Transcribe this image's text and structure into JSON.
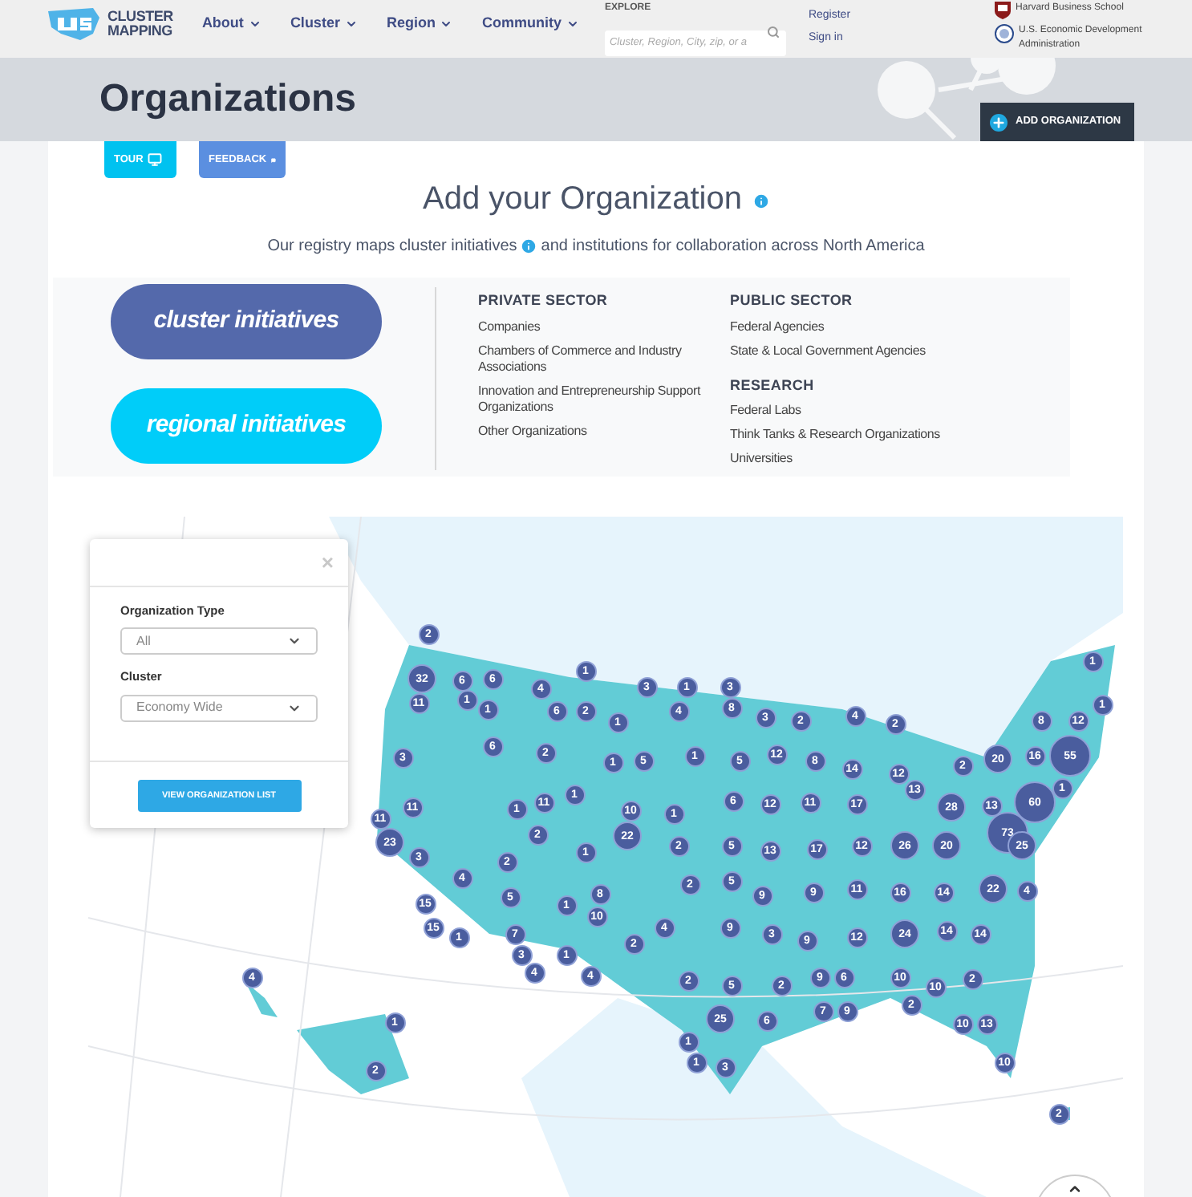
{
  "header": {
    "logo_lines": [
      "CLUSTER",
      "MAPPING"
    ],
    "nav": [
      "About",
      "Cluster",
      "Region",
      "Community"
    ],
    "explore": {
      "label": "EXPLORE",
      "placeholder": "Cluster, Region, City, zip, or a"
    },
    "account_links": [
      "Register",
      "Sign in"
    ],
    "partners": [
      {
        "name": "Harvard Business School",
        "kind": "shield"
      },
      {
        "name": "U.S. Economic Development Administration",
        "kind": "seal"
      }
    ]
  },
  "banner": {
    "title": "Organizations",
    "add_button": "ADD ORGANIZATION"
  },
  "tabs": [
    {
      "label": "TOUR",
      "kind": "tour"
    },
    {
      "label": "FEEDBACK",
      "kind": "feedback"
    }
  ],
  "intro": {
    "heading": "Add your Organization",
    "subtitle_before": "Our registry maps cluster initiatives",
    "subtitle_after": "and institutions for collaboration across North America"
  },
  "initiatives": [
    {
      "label": "cluster initiatives",
      "color": "#5469ab"
    },
    {
      "label": "regional initiatives",
      "color": "#00cdf9"
    }
  ],
  "sectors": [
    {
      "groups": [
        {
          "title": "PRIVATE SECTOR",
          "items": [
            "Companies",
            "Chambers of Commerce and Industry Associations",
            "Innovation and Entrepreneurship Support Organizations",
            "Other Organizations"
          ]
        }
      ]
    },
    {
      "groups": [
        {
          "title": "PUBLIC SECTOR",
          "items": [
            "Federal Agencies",
            "State & Local Government Agencies"
          ]
        },
        {
          "title": "RESEARCH",
          "items": [
            "Federal Labs",
            "Think Tanks & Research Organizations",
            "Universities"
          ]
        }
      ]
    }
  ],
  "filter": {
    "close": "×",
    "fields": [
      {
        "label": "Organization Type",
        "value": "All"
      },
      {
        "label": "Cluster",
        "value": "Economy Wide"
      }
    ],
    "button": "VIEW ORGANIZATION LIST"
  },
  "markers": [
    "2",
    "1",
    "1",
    "32",
    "6",
    "6",
    "4",
    "3",
    "1",
    "3",
    "11",
    "1",
    "1",
    "8",
    "1",
    "6",
    "2",
    "1",
    "4",
    "3",
    "2",
    "4",
    "2",
    "8",
    "12",
    "6",
    "2",
    "3",
    "1",
    "5",
    "1",
    "5",
    "12",
    "8",
    "14",
    "12",
    "2",
    "20",
    "16",
    "55",
    "13",
    "1",
    "11",
    "1",
    "6",
    "12",
    "11",
    "17",
    "60",
    "11",
    "1",
    "10",
    "1",
    "28",
    "13",
    "11",
    "23",
    "2",
    "22",
    "73",
    "3",
    "2",
    "1",
    "2",
    "5",
    "13",
    "17",
    "12",
    "26",
    "20",
    "25",
    "4",
    "2",
    "5",
    "5",
    "8",
    "9",
    "9",
    "11",
    "16",
    "14",
    "22",
    "4",
    "15",
    "1",
    "10",
    "15",
    "1",
    "7",
    "4",
    "9",
    "3",
    "12",
    "24",
    "14",
    "14",
    "2",
    "9",
    "3",
    "1",
    "4",
    "4",
    "4",
    "2",
    "9",
    "6",
    "10",
    "2",
    "5",
    "2",
    "10",
    "2",
    "1",
    "25",
    "6",
    "7",
    "9",
    "10",
    "13",
    "1",
    "1",
    "3",
    "10",
    "2",
    "2"
  ]
}
